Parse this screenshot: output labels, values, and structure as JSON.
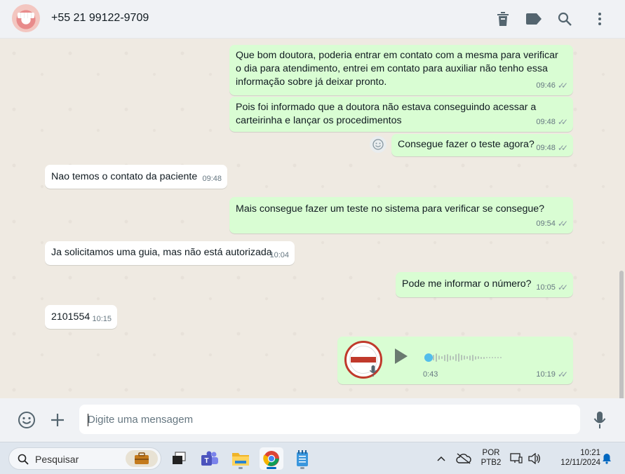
{
  "header": {
    "contact_name": "+55 21 99122-9709",
    "icons": [
      "trash-icon",
      "label-icon",
      "search-icon",
      "more-vert-icon"
    ]
  },
  "messages": [
    {
      "direction": "out",
      "text": "Que bom doutora, poderia entrar em contato com a mesma para verificar o dia para atendimento, entrei em contato para auxiliar não tenho essa informação sobre já deixar pronto.",
      "time": "09:46",
      "status": "read"
    },
    {
      "direction": "out",
      "text": "Pois foi informado que a doutora não estava conseguindo acessar a carteirinha e lançar os procedimentos",
      "time": "09:48",
      "status": "read"
    },
    {
      "direction": "out",
      "text": "Consegue fazer o teste agora?",
      "time": "09:48",
      "status": "read"
    },
    {
      "direction": "in",
      "text": "Nao temos o contato da paciente",
      "time": "09:48"
    },
    {
      "direction": "out",
      "text": "Mais consegue fazer um teste no sistema para verificar se consegue?",
      "time": "09:54",
      "status": "read"
    },
    {
      "direction": "in",
      "text": "Ja solicitamos uma guia, mas não está autorizada",
      "time": "10:04"
    },
    {
      "direction": "out",
      "text": "Pode me informar o número?",
      "time": "10:05",
      "status": "read"
    },
    {
      "direction": "in",
      "text": "2101554",
      "time": "10:15"
    },
    {
      "direction": "out",
      "type": "audio",
      "duration": "0:43",
      "time": "10:19",
      "status": "read",
      "progress": 0
    }
  ],
  "ticks_glyph": "✓✓",
  "composer": {
    "placeholder": "Digite uma mensagem"
  },
  "taskbar": {
    "search_label": "Pesquisar",
    "lang_top": "POR",
    "lang_bottom": "PTB2",
    "clock_time": "10:21",
    "clock_date": "12/11/2024"
  },
  "colors": {
    "outgoing_bubble": "#d9fdd3",
    "incoming_bubble": "#ffffff",
    "read_ticks": "#8696a0",
    "audio_dot": "#53bdeb"
  }
}
